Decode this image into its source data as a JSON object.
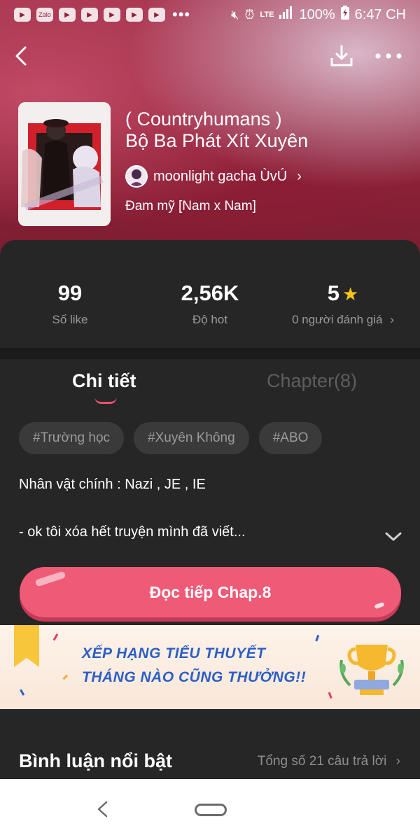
{
  "status_bar": {
    "app_icons": [
      "youtube-icon",
      "zalo-icon",
      "youtube-icon",
      "youtube-icon",
      "youtube-icon",
      "youtube-icon",
      "youtube-icon"
    ],
    "zalo_label": "Zalo",
    "more_dots": "•••",
    "network": "LTE",
    "battery": "100%",
    "time": "6:47 CH"
  },
  "story": {
    "title_line1": "( Countryhumans )",
    "title_line2": "Bộ Ba Phát Xít Xuyên",
    "author": "moonlight gacha ÙvÚ",
    "genre": "Đam mỹ [Nam x Nam]"
  },
  "stats": {
    "likes": {
      "value": "99",
      "label": "Số like"
    },
    "hot": {
      "value": "2,56K",
      "label": "Độ hot"
    },
    "rating": {
      "value": "5",
      "label": "0 người đánh giá"
    }
  },
  "tabs": {
    "details": "Chi tiết",
    "chapters": "Chapter(8)"
  },
  "tags": [
    "#Trường học",
    "#Xuyên Không",
    "#ABO"
  ],
  "description": {
    "main_characters": "Nhân vật chính : Nazi , JE , IE",
    "summary": "- ok tôi xóa hết truyện mình đã viết..."
  },
  "read_button": "Đọc tiếp Chap.8",
  "banner": {
    "line1": "XẾP HẠNG TIỂU THUYẾT",
    "line2": "THÁNG NÀO CŨNG THƯỞNG!!"
  },
  "comments": {
    "title": "Bình luận nổi bật",
    "total": "Tổng số 21 câu trả lời"
  },
  "colors": {
    "accent": "#ef5a76",
    "star": "#f5c518",
    "banner_text": "#2c5fc5"
  }
}
